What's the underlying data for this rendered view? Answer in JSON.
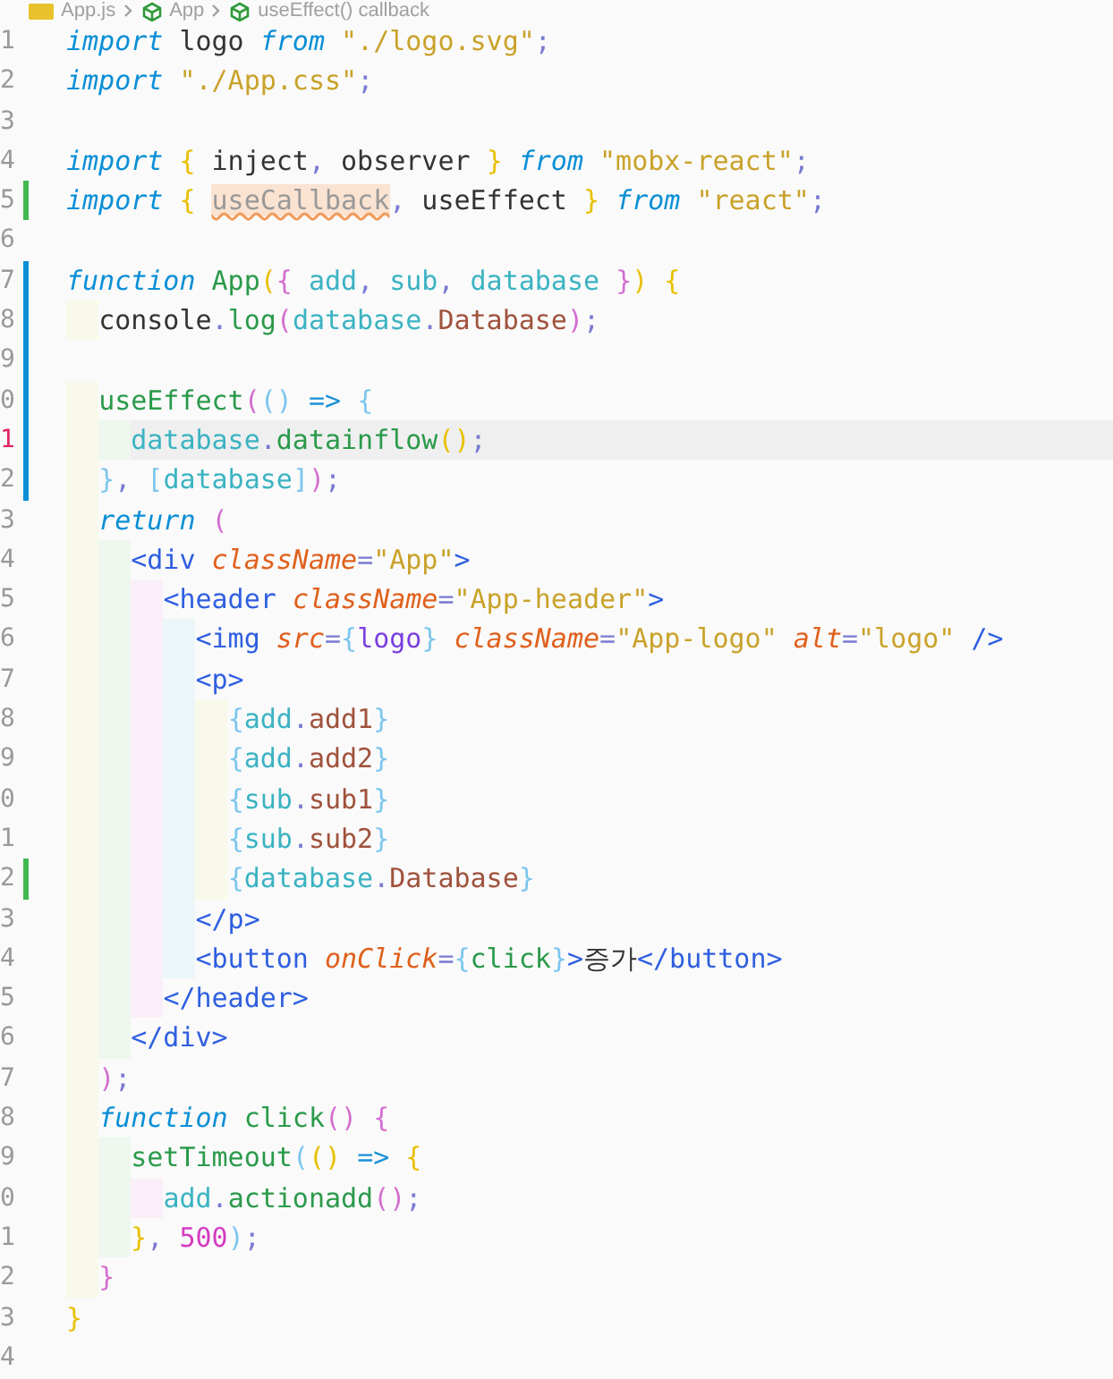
{
  "breadcrumb": [
    {
      "kind": "file",
      "text": "App.js"
    },
    {
      "kind": "symbol",
      "text": "App"
    },
    {
      "kind": "symbol",
      "text": "useEffect() callback"
    }
  ],
  "lines": [
    {
      "number": "1",
      "added": false,
      "modified": false,
      "current": false,
      "tokens": [
        {
          "kind": "keyword",
          "text": "import"
        },
        {
          "kind": "plain",
          "text": " logo "
        },
        {
          "kind": "keyword",
          "text": "from "
        },
        {
          "kind": "string",
          "text": "\"./logo.svg\""
        },
        {
          "kind": "punct",
          "text": ";"
        }
      ]
    },
    {
      "number": "2",
      "added": false,
      "modified": false,
      "current": false,
      "tokens": [
        {
          "kind": "keyword",
          "text": "import "
        },
        {
          "kind": "string",
          "text": "\"./App.css\""
        },
        {
          "kind": "punct",
          "text": ";"
        }
      ]
    },
    {
      "number": "3",
      "added": false,
      "modified": false,
      "current": false
    },
    {
      "number": "4",
      "added": false,
      "modified": false,
      "current": false,
      "tokens": [
        {
          "kind": "keyword",
          "text": "import "
        },
        {
          "kind": "bracket1",
          "text": "{"
        },
        {
          "kind": "plain",
          "text": " inject"
        },
        {
          "kind": "punct",
          "text": ","
        },
        {
          "kind": "plain",
          "text": " observer "
        },
        {
          "kind": "bracket1",
          "text": "} "
        },
        {
          "kind": "keyword",
          "text": "from "
        },
        {
          "kind": "string",
          "text": "\"mobx-react\""
        },
        {
          "kind": "punct",
          "text": ";"
        }
      ]
    },
    {
      "number": "5",
      "added": true,
      "modified": false,
      "current": false,
      "tokens": [
        {
          "kind": "keyword",
          "text": "import "
        },
        {
          "kind": "bracket1",
          "text": "{ "
        },
        {
          "kind": "warning",
          "text": "useCallback"
        },
        {
          "kind": "punct",
          "text": ","
        },
        {
          "kind": "plain",
          "text": " useEffect "
        },
        {
          "kind": "bracket1",
          "text": "} "
        },
        {
          "kind": "keyword",
          "text": "from "
        },
        {
          "kind": "string",
          "text": "\"react\""
        },
        {
          "kind": "punct",
          "text": ";"
        }
      ]
    },
    {
      "number": "6",
      "added": false,
      "modified": false,
      "current": false
    },
    {
      "number": "7",
      "added": false,
      "modified": true,
      "current": false,
      "tokens": [
        {
          "kind": "keyword",
          "text": "function "
        },
        {
          "kind": "function",
          "text": "App"
        },
        {
          "kind": "bracket1",
          "text": "("
        },
        {
          "kind": "bracket2",
          "text": "{"
        },
        {
          "kind": "param",
          "text": " add"
        },
        {
          "kind": "punct",
          "text": ","
        },
        {
          "kind": "param",
          "text": " sub"
        },
        {
          "kind": "punct",
          "text": ","
        },
        {
          "kind": "param",
          "text": " database "
        },
        {
          "kind": "bracket2",
          "text": "}"
        },
        {
          "kind": "bracket1",
          "text": ") {"
        }
      ]
    },
    {
      "number": "8",
      "added": false,
      "modified": true,
      "current": false,
      "tokens": [
        {
          "kind": "plain",
          "text": "  console"
        },
        {
          "kind": "punct",
          "text": "."
        },
        {
          "kind": "function",
          "text": "log"
        },
        {
          "kind": "bracket2",
          "text": "("
        },
        {
          "kind": "param",
          "text": "database"
        },
        {
          "kind": "punct",
          "text": "."
        },
        {
          "kind": "property",
          "text": "Database"
        },
        {
          "kind": "bracket2",
          "text": ")"
        },
        {
          "kind": "punct",
          "text": ";"
        }
      ]
    },
    {
      "number": "9",
      "added": false,
      "modified": true,
      "current": false
    },
    {
      "number": "0",
      "added": false,
      "modified": true,
      "current": false,
      "tokens": [
        {
          "kind": "function",
          "text": "  useEffect"
        },
        {
          "kind": "bracket2",
          "text": "("
        },
        {
          "kind": "bracket3",
          "text": "() "
        },
        {
          "kind": "arrow",
          "text": "=> "
        },
        {
          "kind": "bracket3",
          "text": "{"
        }
      ]
    },
    {
      "number": "1",
      "added": false,
      "modified": true,
      "current": true,
      "tokens": [
        {
          "kind": "param",
          "text": "    database"
        },
        {
          "kind": "punct",
          "text": "."
        },
        {
          "kind": "function",
          "text": "datainflow"
        },
        {
          "kind": "bracket1",
          "text": "()"
        },
        {
          "kind": "punct",
          "text": ";"
        }
      ]
    },
    {
      "number": "2",
      "added": false,
      "modified": true,
      "current": false,
      "tokens": [
        {
          "kind": "bracket3",
          "text": "  }"
        },
        {
          "kind": "punct",
          "text": ", "
        },
        {
          "kind": "bracket3",
          "text": "["
        },
        {
          "kind": "param",
          "text": "database"
        },
        {
          "kind": "bracket3",
          "text": "]"
        },
        {
          "kind": "bracket2",
          "text": ")"
        },
        {
          "kind": "punct",
          "text": ";"
        }
      ]
    },
    {
      "number": "3",
      "added": false,
      "modified": false,
      "current": false,
      "tokens": [
        {
          "kind": "keyword",
          "text": "  return "
        },
        {
          "kind": "bracket2",
          "text": "("
        }
      ]
    },
    {
      "number": "4",
      "added": false,
      "modified": false,
      "current": false,
      "tokens": [
        {
          "kind": "tag",
          "text": "    <div "
        },
        {
          "kind": "attribute",
          "text": "className"
        },
        {
          "kind": "punct",
          "text": "="
        },
        {
          "kind": "string",
          "text": "\"App\""
        },
        {
          "kind": "tag",
          "text": ">"
        }
      ]
    },
    {
      "number": "5",
      "added": false,
      "modified": false,
      "current": false,
      "tokens": [
        {
          "kind": "tag",
          "text": "      <header "
        },
        {
          "kind": "attribute",
          "text": "className"
        },
        {
          "kind": "punct",
          "text": "="
        },
        {
          "kind": "string",
          "text": "\"App-header\""
        },
        {
          "kind": "tag",
          "text": ">"
        }
      ]
    },
    {
      "number": "6",
      "added": false,
      "modified": false,
      "current": false,
      "tokens": [
        {
          "kind": "tag",
          "text": "        <img "
        },
        {
          "kind": "attribute",
          "text": "src"
        },
        {
          "kind": "punct",
          "text": "="
        },
        {
          "kind": "bracket3",
          "text": "{"
        },
        {
          "kind": "variable",
          "text": "logo"
        },
        {
          "kind": "bracket3",
          "text": "} "
        },
        {
          "kind": "attribute",
          "text": "className"
        },
        {
          "kind": "punct",
          "text": "="
        },
        {
          "kind": "string",
          "text": "\"App-logo\" "
        },
        {
          "kind": "attribute",
          "text": "alt"
        },
        {
          "kind": "punct",
          "text": "="
        },
        {
          "kind": "string",
          "text": "\"logo\" "
        },
        {
          "kind": "tag",
          "text": "/>"
        }
      ]
    },
    {
      "number": "7",
      "added": false,
      "modified": false,
      "current": false,
      "tokens": [
        {
          "kind": "tag",
          "text": "        <p>"
        }
      ]
    },
    {
      "number": "8",
      "added": false,
      "modified": false,
      "current": false,
      "tokens": [
        {
          "kind": "bracket3",
          "text": "          {"
        },
        {
          "kind": "param",
          "text": "add"
        },
        {
          "kind": "punct",
          "text": "."
        },
        {
          "kind": "property",
          "text": "add1"
        },
        {
          "kind": "bracket3",
          "text": "}"
        }
      ]
    },
    {
      "number": "9",
      "added": false,
      "modified": false,
      "current": false,
      "tokens": [
        {
          "kind": "bracket3",
          "text": "          {"
        },
        {
          "kind": "param",
          "text": "add"
        },
        {
          "kind": "punct",
          "text": "."
        },
        {
          "kind": "property",
          "text": "add2"
        },
        {
          "kind": "bracket3",
          "text": "}"
        }
      ]
    },
    {
      "number": "0",
      "added": false,
      "modified": false,
      "current": false,
      "tokens": [
        {
          "kind": "bracket3",
          "text": "          {"
        },
        {
          "kind": "param",
          "text": "sub"
        },
        {
          "kind": "punct",
          "text": "."
        },
        {
          "kind": "property",
          "text": "sub1"
        },
        {
          "kind": "bracket3",
          "text": "}"
        }
      ]
    },
    {
      "number": "1",
      "added": false,
      "modified": false,
      "current": false,
      "tokens": [
        {
          "kind": "bracket3",
          "text": "          {"
        },
        {
          "kind": "param",
          "text": "sub"
        },
        {
          "kind": "punct",
          "text": "."
        },
        {
          "kind": "property",
          "text": "sub2"
        },
        {
          "kind": "bracket3",
          "text": "}"
        }
      ]
    },
    {
      "number": "2",
      "added": true,
      "modified": false,
      "current": false,
      "tokens": [
        {
          "kind": "bracket3",
          "text": "          {"
        },
        {
          "kind": "param",
          "text": "database"
        },
        {
          "kind": "punct",
          "text": "."
        },
        {
          "kind": "property",
          "text": "Database"
        },
        {
          "kind": "bracket3",
          "text": "}"
        }
      ]
    },
    {
      "number": "3",
      "added": false,
      "modified": false,
      "current": false,
      "tokens": [
        {
          "kind": "tag",
          "text": "        </p>"
        }
      ]
    },
    {
      "number": "4",
      "added": false,
      "modified": false,
      "current": false,
      "tokens": [
        {
          "kind": "tag",
          "text": "        <button "
        },
        {
          "kind": "attribute",
          "text": "onClick"
        },
        {
          "kind": "punct",
          "text": "="
        },
        {
          "kind": "bracket3",
          "text": "{"
        },
        {
          "kind": "function",
          "text": "click"
        },
        {
          "kind": "bracket3",
          "text": "}"
        },
        {
          "kind": "tag",
          "text": ">"
        },
        {
          "kind": "plain",
          "text": "증가"
        },
        {
          "kind": "tag",
          "text": "</button>"
        }
      ]
    },
    {
      "number": "5",
      "added": false,
      "modified": false,
      "current": false,
      "tokens": [
        {
          "kind": "tag",
          "text": "      </header>"
        }
      ]
    },
    {
      "number": "6",
      "added": false,
      "modified": false,
      "current": false,
      "tokens": [
        {
          "kind": "tag",
          "text": "    </div>"
        }
      ]
    },
    {
      "number": "7",
      "added": false,
      "modified": false,
      "current": false,
      "tokens": [
        {
          "kind": "bracket2",
          "text": "  )"
        },
        {
          "kind": "punct",
          "text": ";"
        }
      ]
    },
    {
      "number": "8",
      "added": false,
      "modified": false,
      "current": false,
      "tokens": [
        {
          "kind": "keyword",
          "text": "  function "
        },
        {
          "kind": "function",
          "text": "click"
        },
        {
          "kind": "bracket2",
          "text": "() {"
        }
      ]
    },
    {
      "number": "9",
      "added": false,
      "modified": false,
      "current": false,
      "tokens": [
        {
          "kind": "function",
          "text": "    setTimeout"
        },
        {
          "kind": "bracket3",
          "text": "("
        },
        {
          "kind": "bracket1",
          "text": "() "
        },
        {
          "kind": "arrow",
          "text": "=> "
        },
        {
          "kind": "bracket1",
          "text": "{"
        }
      ]
    },
    {
      "number": "0",
      "added": false,
      "modified": false,
      "current": false,
      "tokens": [
        {
          "kind": "param",
          "text": "      add"
        },
        {
          "kind": "punct",
          "text": "."
        },
        {
          "kind": "function",
          "text": "actionadd"
        },
        {
          "kind": "bracket2",
          "text": "()"
        },
        {
          "kind": "punct",
          "text": ";"
        }
      ]
    },
    {
      "number": "1",
      "added": false,
      "modified": false,
      "current": false,
      "tokens": [
        {
          "kind": "bracket1",
          "text": "    }"
        },
        {
          "kind": "punct",
          "text": ", "
        },
        {
          "kind": "number",
          "text": "500"
        },
        {
          "kind": "bracket3",
          "text": ")"
        },
        {
          "kind": "punct",
          "text": ";"
        }
      ]
    },
    {
      "number": "2",
      "added": false,
      "modified": false,
      "current": false,
      "tokens": [
        {
          "kind": "bracket2",
          "text": "  }"
        }
      ]
    },
    {
      "number": "3",
      "added": false,
      "modified": false,
      "current": false,
      "tokens": [
        {
          "kind": "bracket1",
          "text": "}"
        }
      ]
    },
    {
      "number": "4",
      "added": false,
      "modified": false,
      "current": false
    }
  ]
}
